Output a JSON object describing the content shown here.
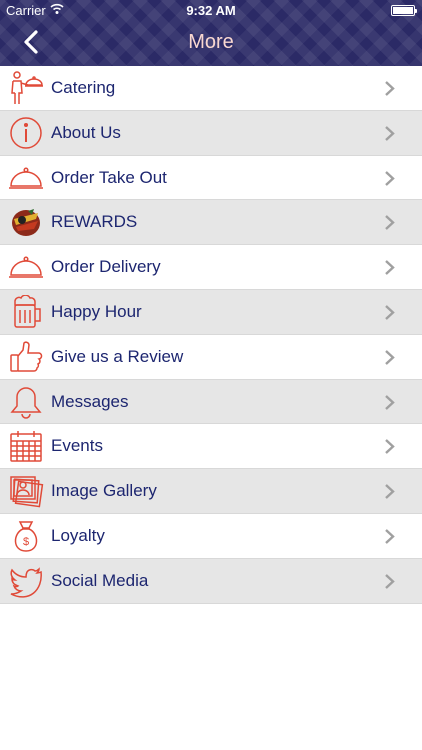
{
  "status_bar": {
    "carrier": "Carrier",
    "time": "9:32 AM"
  },
  "header": {
    "title": "More"
  },
  "colors": {
    "header_bg": "#2b2a66",
    "label": "#1d2670",
    "icon": "#e04a38",
    "chevron": "#a0a0a0"
  },
  "menu": [
    {
      "label": "Catering",
      "icon": "waiter-icon"
    },
    {
      "label": "About Us",
      "icon": "info-icon"
    },
    {
      "label": "Order Take Out",
      "icon": "cloche-icon"
    },
    {
      "label": "REWARDS",
      "icon": "team-logo-icon"
    },
    {
      "label": "Order Delivery",
      "icon": "cloche-icon"
    },
    {
      "label": "Happy Hour",
      "icon": "beer-mug-icon"
    },
    {
      "label": "Give us a Review",
      "icon": "thumbs-up-icon"
    },
    {
      "label": "Messages",
      "icon": "bell-icon"
    },
    {
      "label": "Events",
      "icon": "calendar-icon"
    },
    {
      "label": "Image Gallery",
      "icon": "gallery-icon"
    },
    {
      "label": "Loyalty",
      "icon": "money-bag-icon"
    },
    {
      "label": "Social Media",
      "icon": "twitter-bird-icon"
    }
  ]
}
